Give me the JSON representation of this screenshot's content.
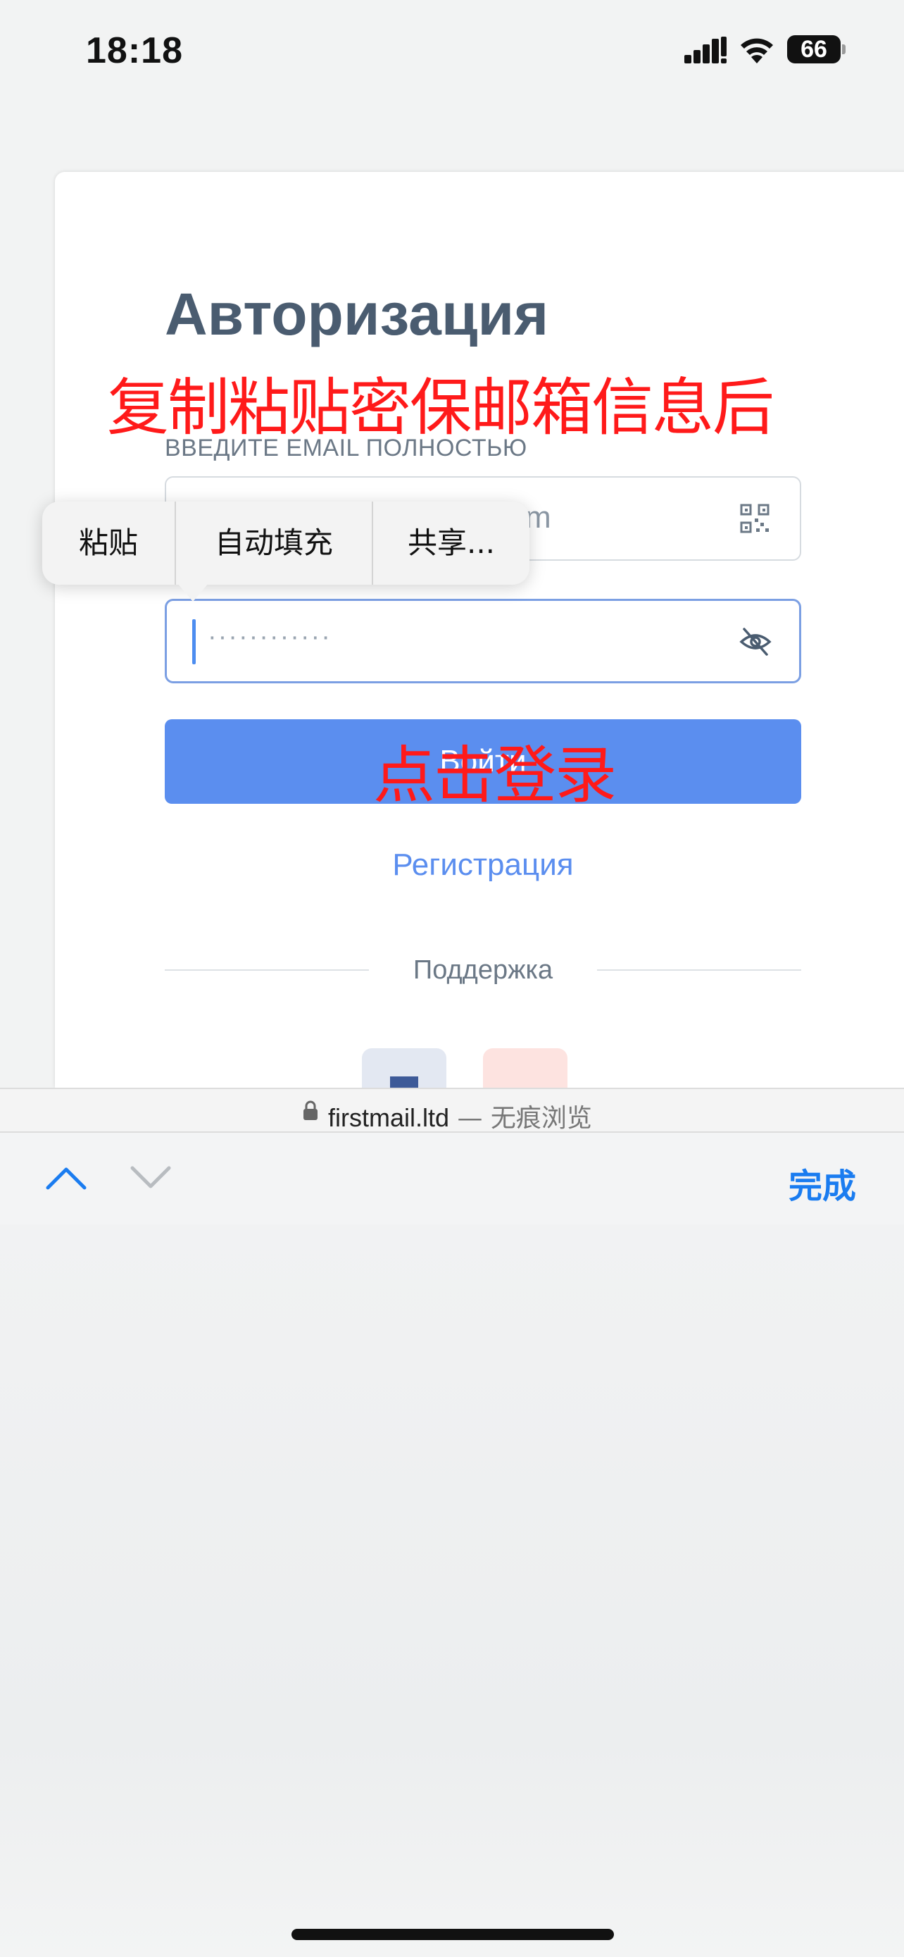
{
  "status_bar": {
    "time": "18:18",
    "battery_level": "66"
  },
  "page": {
    "title": "Авторизация",
    "email_label": "ВВЕДИТЕ EMAIL ПОЛНОСТЬЮ",
    "email_value_visible": "m",
    "password_mask": "············",
    "login_button_label": "Войти",
    "register_link": "Регистрация",
    "support_label": "Поддержка"
  },
  "annotations": {
    "top": "复制粘贴密保邮箱信息后",
    "login": "点击登录"
  },
  "context_menu": {
    "items": [
      "粘贴",
      "自动填充",
      "共享..."
    ]
  },
  "address_bar": {
    "domain": "firstmail.ltd",
    "suffix": " — 无痕浏览"
  },
  "keyboard_toolbar": {
    "done_label": "完成"
  },
  "colors": {
    "accent": "#5b8eef",
    "title": "#4a5c70",
    "annotation": "#ff1a1a",
    "done": "#1a7cf0"
  },
  "icons": [
    "signal-icon",
    "wifi-icon",
    "qr-code-icon",
    "eye-off-icon",
    "lock-icon",
    "chevron-up-icon",
    "chevron-down-icon"
  ]
}
